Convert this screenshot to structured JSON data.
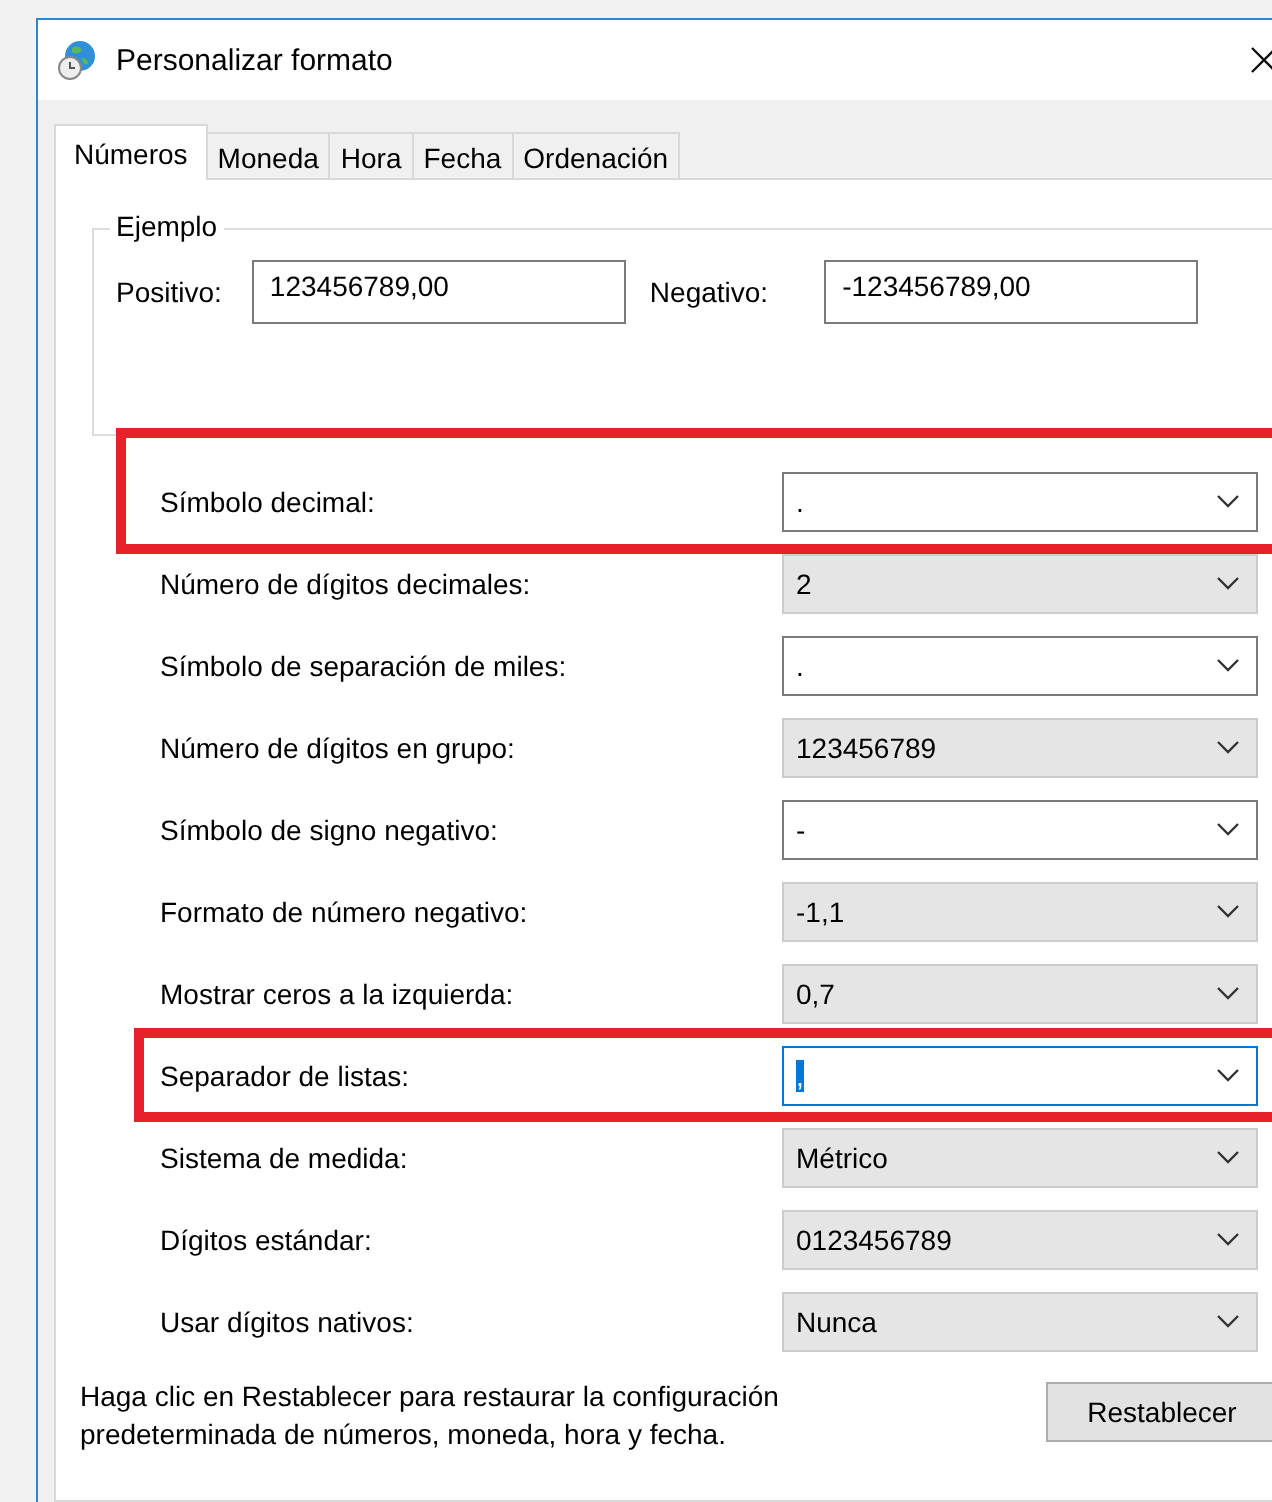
{
  "window": {
    "title": "Personalizar formato"
  },
  "tabs": [
    {
      "label": "Números",
      "selected": true
    },
    {
      "label": "Moneda",
      "selected": false
    },
    {
      "label": "Hora",
      "selected": false
    },
    {
      "label": "Fecha",
      "selected": false
    },
    {
      "label": "Ordenación",
      "selected": false
    }
  ],
  "example": {
    "title": "Ejemplo",
    "positive_label": "Positivo:",
    "positive_value": "123456789,00",
    "negative_label": "Negativo:",
    "negative_value": "-123456789,00"
  },
  "settings": [
    {
      "label": "Símbolo decimal:",
      "value": ".",
      "kind": "editable",
      "highlighted": true,
      "focused": false
    },
    {
      "label": "Número de dígitos decimales:",
      "value": "2",
      "kind": "list",
      "highlighted": false,
      "focused": false
    },
    {
      "label": "Símbolo de separación de miles:",
      "value": ".",
      "kind": "editable",
      "highlighted": false,
      "focused": false
    },
    {
      "label": "Número de dígitos en grupo:",
      "value": "123456789",
      "kind": "list",
      "highlighted": false,
      "focused": false
    },
    {
      "label": "Símbolo de signo negativo:",
      "value": "-",
      "kind": "editable",
      "highlighted": false,
      "focused": false
    },
    {
      "label": "Formato de número negativo:",
      "value": "-1,1",
      "kind": "list",
      "highlighted": false,
      "focused": false
    },
    {
      "label": "Mostrar ceros a la izquierda:",
      "value": "0,7",
      "kind": "list",
      "highlighted": false,
      "focused": false
    },
    {
      "label": "Separador de listas:",
      "value": ",",
      "kind": "editable",
      "highlighted": true,
      "focused": true
    },
    {
      "label": "Sistema de medida:",
      "value": "Métrico",
      "kind": "list",
      "highlighted": false,
      "focused": false
    },
    {
      "label": "Dígitos estándar:",
      "value": "0123456789",
      "kind": "list",
      "highlighted": false,
      "focused": false
    },
    {
      "label": "Usar dígitos nativos:",
      "value": "Nunca",
      "kind": "list",
      "highlighted": false,
      "focused": false
    }
  ],
  "footer": {
    "note": "Haga clic en Restablecer para restaurar la configuración predeterminada de números, moneda, hora y fecha.",
    "reset_button": "Restablecer"
  }
}
